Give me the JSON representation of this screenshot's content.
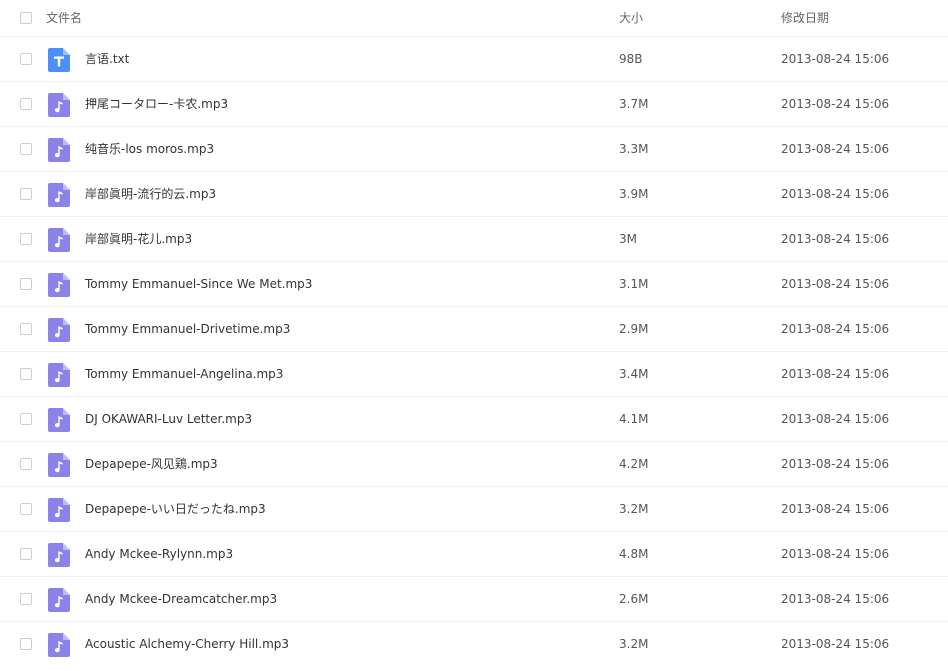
{
  "header": {
    "name_label": "文件名",
    "size_label": "大小",
    "date_label": "修改日期"
  },
  "colors": {
    "text_icon": "#4d8ff6",
    "audio_icon": "#8a84ea"
  },
  "files": [
    {
      "name": "言语.txt",
      "size": "98B",
      "date": "2013-08-24 15:06",
      "icon": "text-file-icon"
    },
    {
      "name": "押尾コータロー-卡农.mp3",
      "size": "3.7M",
      "date": "2013-08-24 15:06",
      "icon": "audio-file-icon"
    },
    {
      "name": "纯音乐-los moros.mp3",
      "size": "3.3M",
      "date": "2013-08-24 15:06",
      "icon": "audio-file-icon"
    },
    {
      "name": "岸部眞明-流行的云.mp3",
      "size": "3.9M",
      "date": "2013-08-24 15:06",
      "icon": "audio-file-icon"
    },
    {
      "name": "岸部眞明-花儿.mp3",
      "size": "3M",
      "date": "2013-08-24 15:06",
      "icon": "audio-file-icon"
    },
    {
      "name": "Tommy Emmanuel-Since We Met.mp3",
      "size": "3.1M",
      "date": "2013-08-24 15:06",
      "icon": "audio-file-icon"
    },
    {
      "name": "Tommy Emmanuel-Drivetime.mp3",
      "size": "2.9M",
      "date": "2013-08-24 15:06",
      "icon": "audio-file-icon"
    },
    {
      "name": "Tommy Emmanuel-Angelina.mp3",
      "size": "3.4M",
      "date": "2013-08-24 15:06",
      "icon": "audio-file-icon"
    },
    {
      "name": "DJ OKAWARI-Luv Letter.mp3",
      "size": "4.1M",
      "date": "2013-08-24 15:06",
      "icon": "audio-file-icon"
    },
    {
      "name": "Depapepe-风见鶏.mp3",
      "size": "4.2M",
      "date": "2013-08-24 15:06",
      "icon": "audio-file-icon"
    },
    {
      "name": "Depapepe-いい日だったね.mp3",
      "size": "3.2M",
      "date": "2013-08-24 15:06",
      "icon": "audio-file-icon"
    },
    {
      "name": "Andy Mckee-Rylynn.mp3",
      "size": "4.8M",
      "date": "2013-08-24 15:06",
      "icon": "audio-file-icon"
    },
    {
      "name": "Andy Mckee-Dreamcatcher.mp3",
      "size": "2.6M",
      "date": "2013-08-24 15:06",
      "icon": "audio-file-icon"
    },
    {
      "name": "Acoustic Alchemy-Cherry Hill.mp3",
      "size": "3.2M",
      "date": "2013-08-24 15:06",
      "icon": "audio-file-icon"
    }
  ]
}
